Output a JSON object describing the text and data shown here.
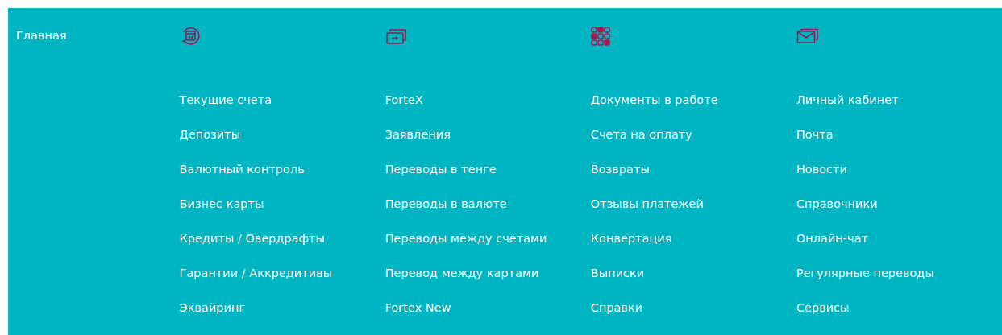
{
  "home": {
    "label": "Главная"
  },
  "columns": [
    {
      "kind": "calendar",
      "items": [
        "Текущие счета",
        "Депозиты",
        "Валютный контроль",
        "Бизнес карты",
        "Кредиты / Овердрафты",
        "Гарантии / Аккредитивы",
        "Эквайринг"
      ]
    },
    {
      "kind": "cards",
      "items": [
        "ForteX",
        "Заявления",
        "Переводы в тенге",
        "Переводы в валюте",
        "Переводы между счетами",
        "Перевод между картами",
        "Fortex New"
      ]
    },
    {
      "kind": "grid",
      "items": [
        "Документы в работе",
        "Счета на оплату",
        "Возвраты",
        "Отзывы платежей",
        "Конвертация",
        "Выписки",
        "Справки"
      ]
    },
    {
      "kind": "mail",
      "items": [
        "Личный кабинет",
        "Почта",
        "Новости",
        "Справочники",
        "Онлайн-чат",
        "Регулярные переводы",
        "Сервисы"
      ]
    }
  ]
}
